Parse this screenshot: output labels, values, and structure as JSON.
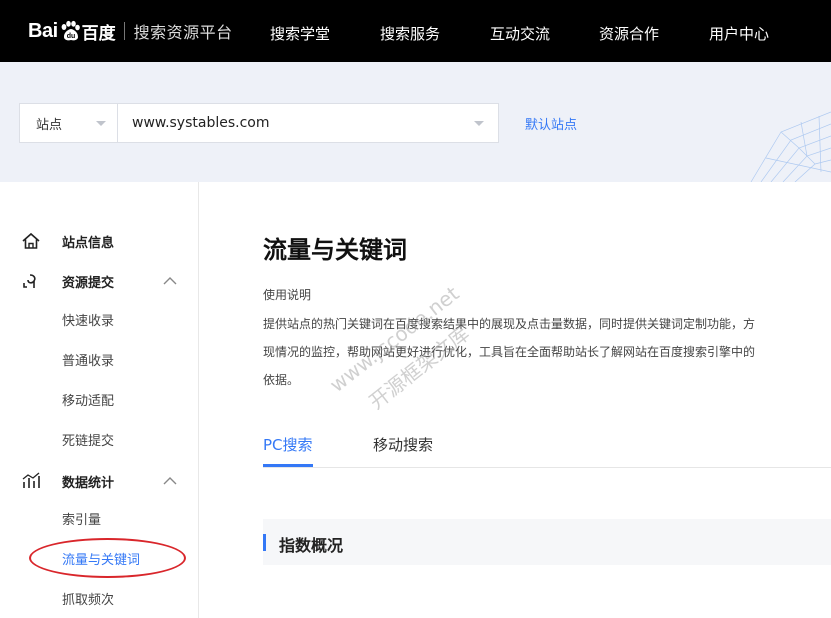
{
  "header": {
    "logo_bai": "Bai",
    "logo_du": "百度",
    "platform": "搜索资源平台",
    "nav": [
      "搜索学堂",
      "搜索服务",
      "互动交流",
      "资源合作",
      "用户中心"
    ]
  },
  "sitebar": {
    "select_label": "站点",
    "site_value": "www.systables.com",
    "default_site": "默认站点"
  },
  "sidebar": {
    "site_info": "站点信息",
    "resource_submit": {
      "label": "资源提交",
      "items": [
        "快速收录",
        "普通收录",
        "移动适配",
        "死链提交"
      ]
    },
    "data_stats": {
      "label": "数据统计",
      "items": [
        "索引量",
        "流量与关键词",
        "抓取频次"
      ]
    }
  },
  "main": {
    "title": "流量与关键词",
    "usage_label": "使用说明",
    "desc_lines": [
      "提供站点的热门关键词在百度搜索结果中的展现及点击量数据，同时提供关键词定制功能，方",
      "现情况的监控，帮助网站更好进行优化，工具旨在全面帮助站长了解网站在百度搜索引擎中的",
      "依据。"
    ],
    "tabs": [
      "PC搜索",
      "移动搜索"
    ],
    "section_title": "指数概况"
  },
  "watermark": {
    "line1": "www.jscode.net",
    "line2": "开源框架文库"
  },
  "colors": {
    "accent": "#3478f6",
    "topbar": "#000000",
    "sitebar_bg": "#eef1f8",
    "annotation_red": "#d9262b"
  }
}
